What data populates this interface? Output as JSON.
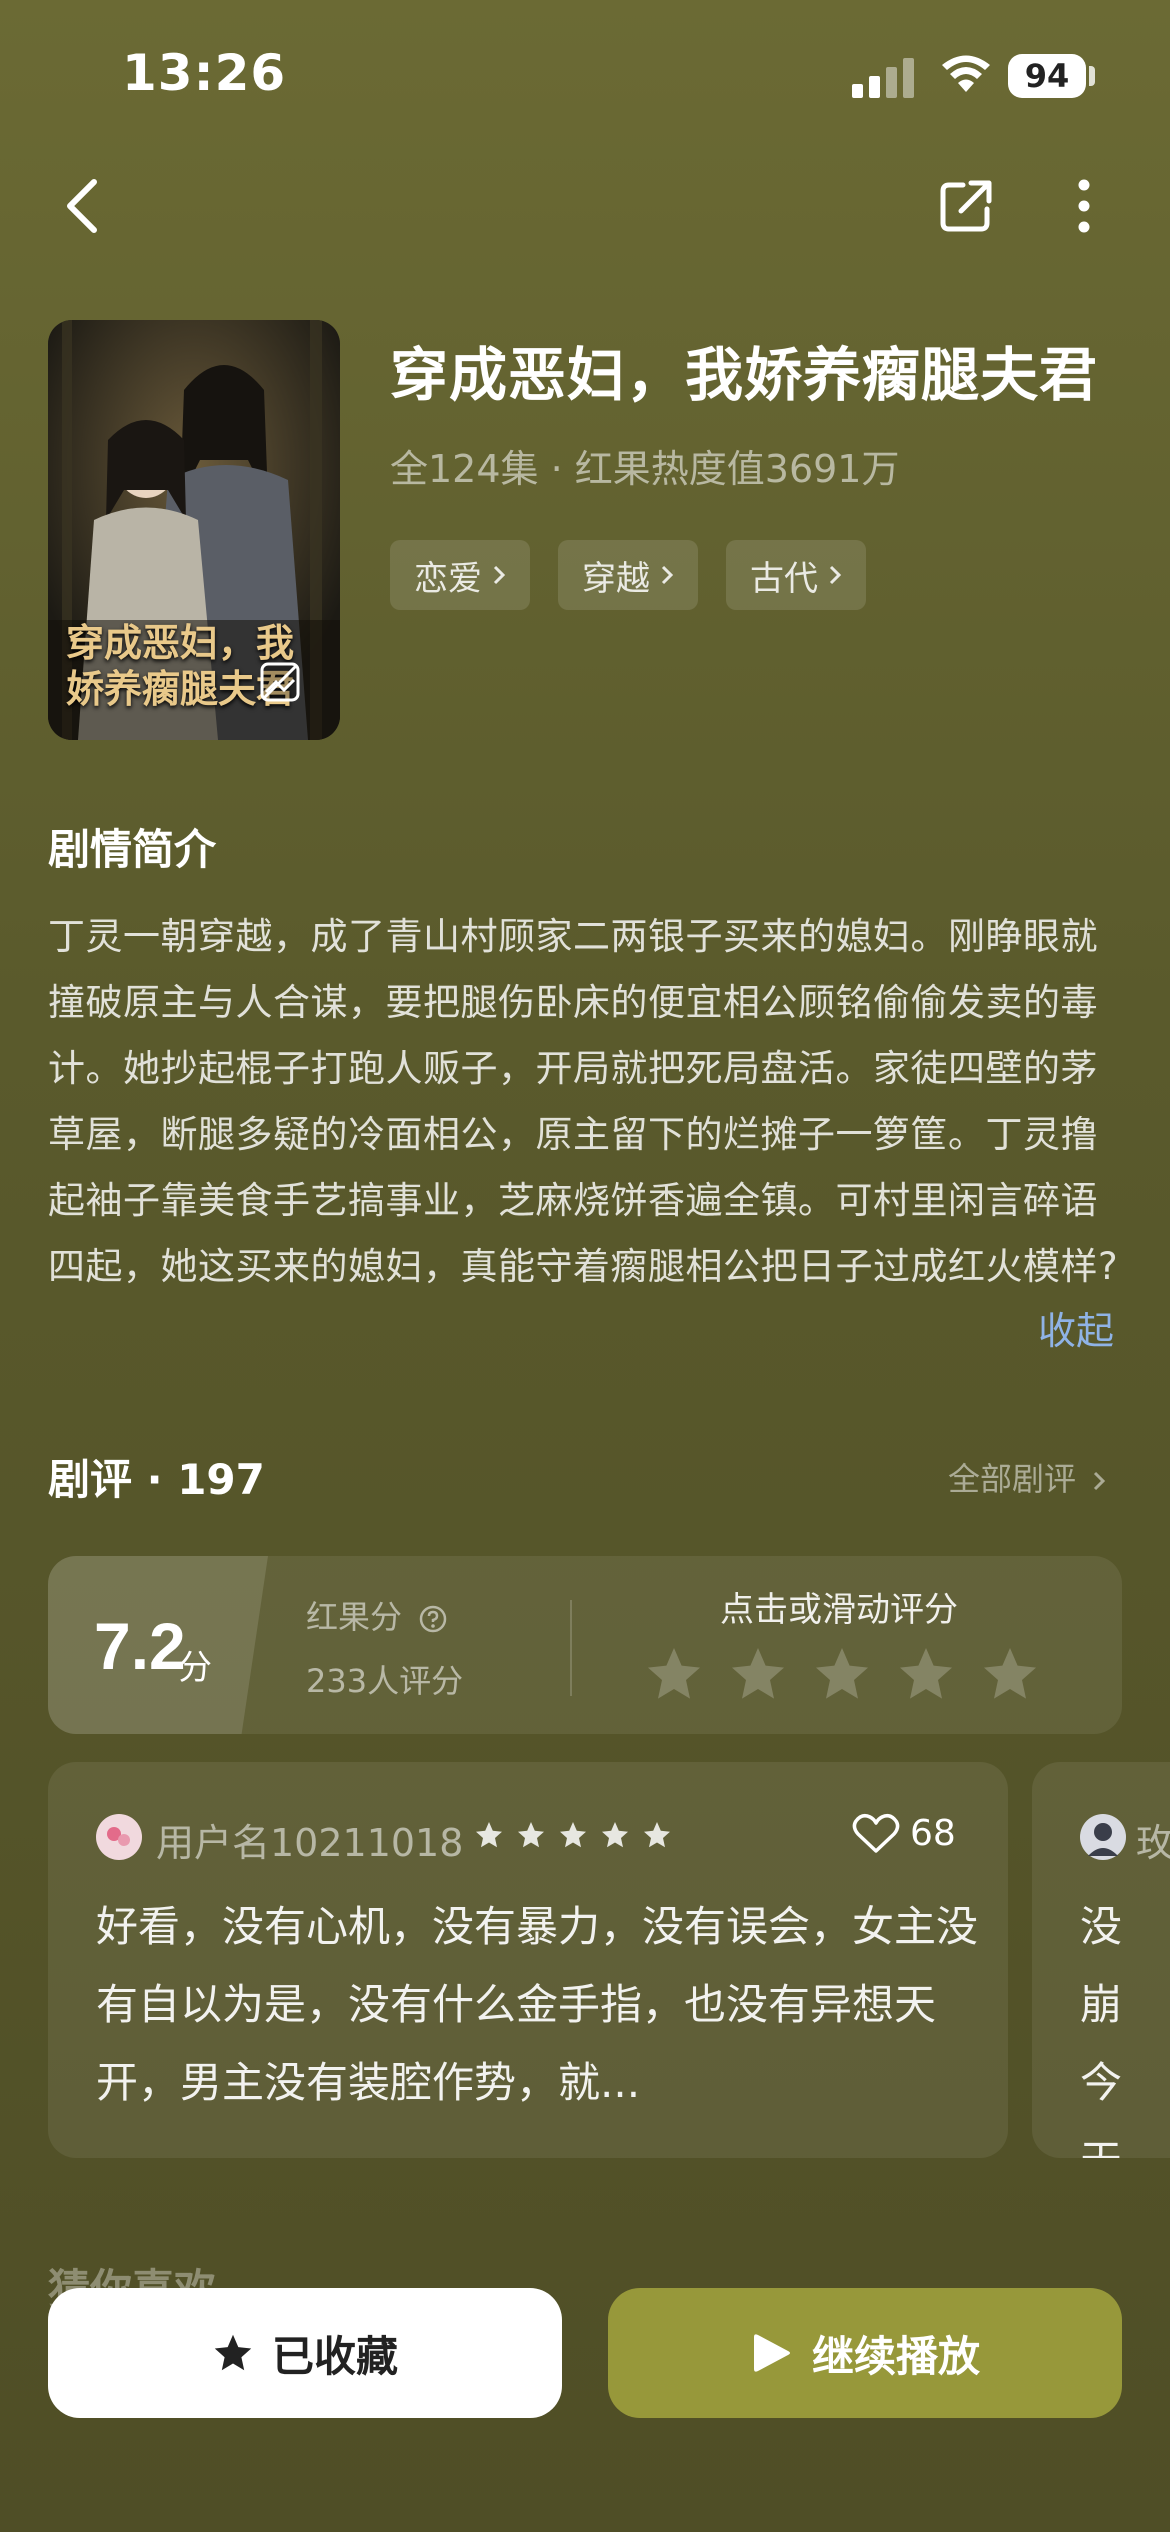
{
  "status_bar": {
    "time": "13:26",
    "battery": "94"
  },
  "drama": {
    "title": "穿成恶妇，我娇养瘸腿夫君",
    "meta": "全124集 · 红果热度值3691万",
    "tags": [
      "恋爱",
      "穿越",
      "古代"
    ],
    "cover_text": "穿成恶妇，我娇养瘸腿夫君"
  },
  "synopsis": {
    "heading": "剧情简介",
    "text": "丁灵一朝穿越，成了青山村顾家二两银子买来的媳妇。刚睁眼就撞破原主与人合谋，要把腿伤卧床的便宜相公顾铭偷偷发卖的毒计。她抄起棍子打跑人贩子，开局就把死局盘活。家徒四壁的茅草屋，断腿多疑的冷面相公，原主留下的烂摊子一箩筐。丁灵撸起袖子靠美食手艺搞事业，芝麻烧饼香遍全镇。可村里闲言碎语四起，她这买来的媳妇，真能守着瘸腿相公把日子过成红火模样?",
    "collapse": "收起"
  },
  "reviews": {
    "heading": "剧评 · 197",
    "all": "全部剧评",
    "rating": {
      "score": "7.2",
      "unit": "分",
      "label": "红果分",
      "count": "233人评分",
      "prompt": "点击或滑动评分",
      "stars": 5
    },
    "items": [
      {
        "user": "用户名10211018",
        "stars": 5,
        "likes": "68",
        "text": "好看，没有心机，没有暴力，没有误会，女主没有自以为是，没有什么金手指，也没有异想天开，男主没有装腔作势，就..."
      },
      {
        "user": "玫",
        "text": "没崩今天有钱"
      }
    ]
  },
  "next_section": "猜你喜欢",
  "actions": {
    "collected": "已收藏",
    "play": "继续播放"
  }
}
